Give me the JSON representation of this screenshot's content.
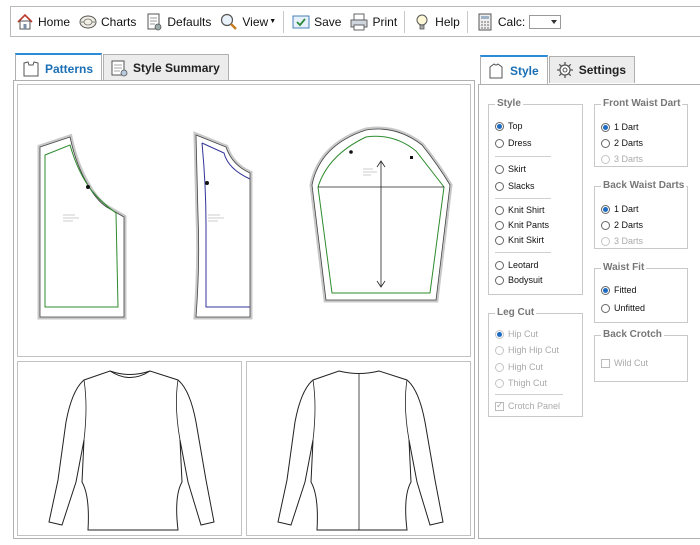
{
  "toolbar": {
    "home": "Home",
    "charts": "Charts",
    "defaults": "Defaults",
    "view": "View",
    "save": "Save",
    "print": "Print",
    "help": "Help",
    "calc": "Calc:",
    "calc_value": ""
  },
  "left_tabs": {
    "patterns": "Patterns",
    "style_summary": "Style Summary"
  },
  "right_tabs": {
    "style": "Style",
    "settings": "Settings"
  },
  "style_group": {
    "title": "Style",
    "options": [
      "Top",
      "Dress",
      "Skirt",
      "Slacks",
      "Knit Shirt",
      "Knit Pants",
      "Knit Skirt",
      "Leotard",
      "Bodysuit"
    ],
    "selected": "Top"
  },
  "front_waist_dart": {
    "title": "Front Waist Dart",
    "options": [
      "1 Dart",
      "2 Darts",
      "3 Darts"
    ],
    "selected": "1 Dart"
  },
  "back_waist_darts": {
    "title": "Back Waist Darts",
    "options": [
      "1 Dart",
      "2 Darts",
      "3 Darts"
    ],
    "selected": "1 Dart"
  },
  "waist_fit": {
    "title": "Waist Fit",
    "options": [
      "Fitted",
      "Unfitted"
    ],
    "selected": "Fitted"
  },
  "leg_cut": {
    "title": "Leg Cut",
    "options": [
      "Hip Cut",
      "High Hip Cut",
      "High Cut",
      "Thigh Cut"
    ],
    "selected": "Hip Cut",
    "crotch_panel": "Crotch Panel"
  },
  "back_crotch": {
    "title": "Back Crotch",
    "wild_cut": "Wild Cut"
  }
}
